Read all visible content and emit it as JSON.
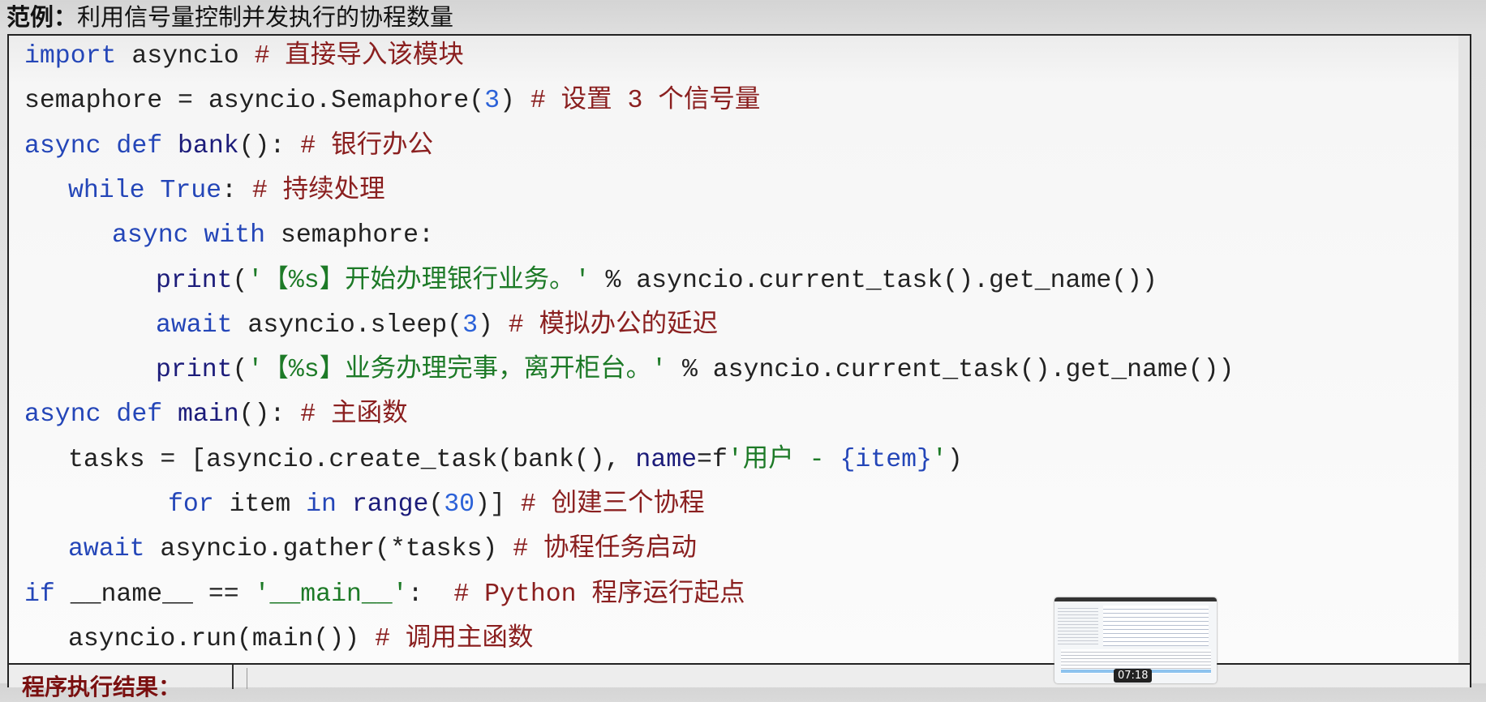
{
  "title": {
    "prefix": "范例：",
    "text": "利用信号量控制并发执行的协程数量"
  },
  "code": {
    "lines": [
      {
        "indent": 0,
        "tokens": [
          {
            "t": "import",
            "c": "kw"
          },
          {
            "t": " asyncio ",
            "c": "tx"
          },
          {
            "t": "# 直接导入该模块",
            "c": "cm"
          }
        ]
      },
      {
        "indent": 0,
        "tokens": [
          {
            "t": "semaphore = asyncio.Semaphore(",
            "c": "tx"
          },
          {
            "t": "3",
            "c": "nm"
          },
          {
            "t": ") ",
            "c": "tx"
          },
          {
            "t": "# 设置 3 个信号量",
            "c": "cm"
          }
        ]
      },
      {
        "indent": 0,
        "tokens": [
          {
            "t": "async def ",
            "c": "kw"
          },
          {
            "t": "bank",
            "c": "fn"
          },
          {
            "t": "(): ",
            "c": "tx"
          },
          {
            "t": "# 银行办公",
            "c": "cm"
          }
        ]
      },
      {
        "indent": 1,
        "tokens": [
          {
            "t": "while True",
            "c": "kw"
          },
          {
            "t": ": ",
            "c": "tx"
          },
          {
            "t": "# 持续处理",
            "c": "cm"
          }
        ]
      },
      {
        "indent": 2,
        "tokens": [
          {
            "t": "async with",
            "c": "kw"
          },
          {
            "t": " semaphore:",
            "c": "tx"
          }
        ]
      },
      {
        "indent": 3,
        "tokens": [
          {
            "t": "print",
            "c": "fn"
          },
          {
            "t": "(",
            "c": "tx"
          },
          {
            "t": "'【%s】开始办理银行业务。'",
            "c": "st"
          },
          {
            "t": " % asyncio.current_task().get_name())",
            "c": "tx"
          }
        ]
      },
      {
        "indent": 3,
        "tokens": [
          {
            "t": "await",
            "c": "kw"
          },
          {
            "t": " asyncio.sleep(",
            "c": "tx"
          },
          {
            "t": "3",
            "c": "nm"
          },
          {
            "t": ") ",
            "c": "tx"
          },
          {
            "t": "# 模拟办公的延迟",
            "c": "cm"
          }
        ]
      },
      {
        "indent": 3,
        "tokens": [
          {
            "t": "print",
            "c": "fn"
          },
          {
            "t": "(",
            "c": "tx"
          },
          {
            "t": "'【%s】业务办理完事，离开柜台。'",
            "c": "st"
          },
          {
            "t": " % asyncio.current_task().get_name())",
            "c": "tx"
          }
        ]
      },
      {
        "indent": 0,
        "tokens": [
          {
            "t": "async def ",
            "c": "kw"
          },
          {
            "t": "main",
            "c": "fn"
          },
          {
            "t": "(): ",
            "c": "tx"
          },
          {
            "t": "# 主函数",
            "c": "cm"
          }
        ]
      },
      {
        "indent": 1,
        "tokens": [
          {
            "t": "tasks = [asyncio.create_task(bank(), ",
            "c": "tx"
          },
          {
            "t": "name",
            "c": "fn"
          },
          {
            "t": "=f",
            "c": "tx"
          },
          {
            "t": "'用户 - ",
            "c": "st"
          },
          {
            "t": "{item}",
            "c": "kw"
          },
          {
            "t": "'",
            "c": "st"
          },
          {
            "t": ")",
            "c": "tx"
          }
        ]
      },
      {
        "indent": 4,
        "tokens": [
          {
            "t": "for",
            "c": "kw"
          },
          {
            "t": " item ",
            "c": "tx"
          },
          {
            "t": "in",
            "c": "kw"
          },
          {
            "t": " ",
            "c": "tx"
          },
          {
            "t": "range",
            "c": "fn"
          },
          {
            "t": "(",
            "c": "tx"
          },
          {
            "t": "30",
            "c": "nm"
          },
          {
            "t": ")] ",
            "c": "tx"
          },
          {
            "t": "# 创建三个协程",
            "c": "cm"
          }
        ]
      },
      {
        "indent": 1,
        "tokens": [
          {
            "t": "await",
            "c": "kw"
          },
          {
            "t": " asyncio.gather(*tasks) ",
            "c": "tx"
          },
          {
            "t": "# 协程任务启动",
            "c": "cm"
          }
        ]
      },
      {
        "indent": 0,
        "tokens": [
          {
            "t": "if",
            "c": "kw"
          },
          {
            "t": " __name__ == ",
            "c": "tx"
          },
          {
            "t": "'__main__'",
            "c": "st"
          },
          {
            "t": ":  ",
            "c": "tx"
          },
          {
            "t": "# Python 程序运行起点",
            "c": "cm"
          }
        ]
      },
      {
        "indent": 1,
        "tokens": [
          {
            "t": "asyncio.run(main()) ",
            "c": "tx"
          },
          {
            "t": "# 调用主函数",
            "c": "cm"
          }
        ]
      }
    ]
  },
  "result": {
    "label": "程序执行结果："
  },
  "video": {
    "timestamp": "07:18"
  }
}
